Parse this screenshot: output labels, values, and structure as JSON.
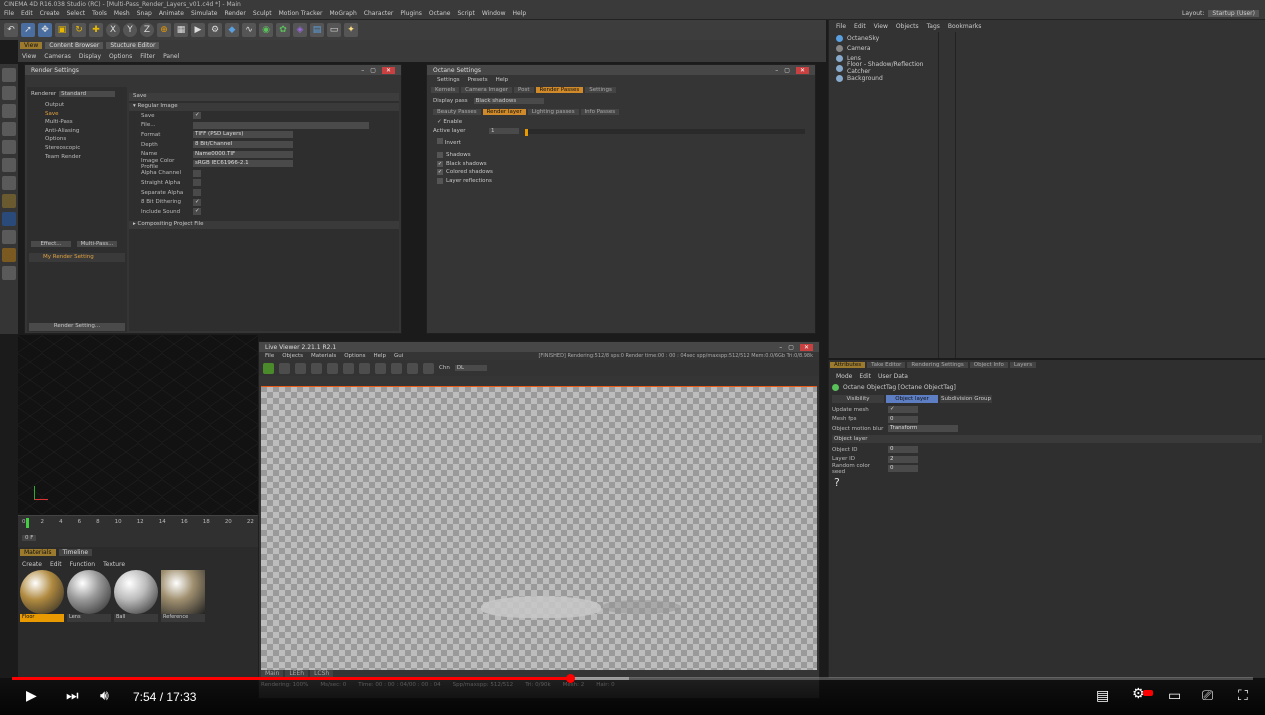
{
  "app": {
    "title": "CINEMA 4D R16.038 Studio (RC) - [Multi-Pass_Render_Layers_v01.c4d *] - Main",
    "menu": [
      "File",
      "Edit",
      "Create",
      "Select",
      "Tools",
      "Mesh",
      "Snap",
      "Animate",
      "Simulate",
      "Render",
      "Sculpt",
      "Motion Tracker",
      "MoGraph",
      "Character",
      "Plugins",
      "Octane",
      "Script",
      "Window",
      "Help"
    ],
    "layout_label": "Layout:",
    "layout_value": "Startup (User)"
  },
  "toolbar": {
    "icons": [
      "undo-icon",
      "select-icon",
      "move-icon",
      "scale-icon",
      "rotate-icon",
      "add-icon",
      "x-axis-icon",
      "y-axis-icon",
      "z-axis-icon",
      "coord-icon",
      "render-view-icon",
      "render-icon",
      "render-settings-icon",
      "cube-icon",
      "spline-icon",
      "nurbs-icon",
      "array-icon",
      "deformer-icon",
      "environment-icon",
      "camera-icon",
      "light-icon"
    ],
    "axis_x": "X",
    "axis_y": "Y",
    "axis_z": "Z"
  },
  "viewport": {
    "tabs": [
      "View",
      "Content Browser",
      "Stucture Editor"
    ],
    "menu": [
      "View",
      "Cameras",
      "Display",
      "Options",
      "Filter",
      "Panel"
    ]
  },
  "render_settings": {
    "title": "Render Settings",
    "renderer_label": "Renderer",
    "renderer_value": "Standard",
    "left_items": [
      "Output",
      "Save",
      "Multi-Pass",
      "Anti-Aliasing",
      "Options",
      "Stereoscopic",
      "Team Render"
    ],
    "effect_btn": "Effect...",
    "multipass_btn": "Multi-Pass...",
    "my_render_setting": "My Render Setting",
    "render_setting_btn": "Render Setting...",
    "section_header": "Save",
    "group_regular": "Regular Image",
    "rows": [
      {
        "label": "Save",
        "value": "✓"
      },
      {
        "label": "File...",
        "value": ""
      },
      {
        "label": "Format",
        "value": "TIFF (PSD Layers)"
      },
      {
        "label": "Depth",
        "value": "8 Bit/Channel"
      },
      {
        "label": "Name",
        "value": "Name0000.TIF"
      },
      {
        "label": "Image Color Profile",
        "value": "sRGB IEC61966-2.1"
      },
      {
        "label": "Alpha Channel",
        "value": ""
      },
      {
        "label": "Straight Alpha",
        "value": ""
      },
      {
        "label": "Separate Alpha",
        "value": ""
      },
      {
        "label": "8 Bit Dithering",
        "value": "✓"
      },
      {
        "label": "Include Sound",
        "value": "✓"
      }
    ],
    "options_btn": "Options...",
    "compositing": "Compositing Project File"
  },
  "octane_settings": {
    "title": "Octane Settings",
    "menu": [
      "Settings",
      "Presets",
      "Help"
    ],
    "tabs": [
      "Kernels",
      "Camera Imager",
      "Post",
      "Render Passes",
      "Settings"
    ],
    "display_pass_label": "Display pass",
    "display_pass_value": "Black shadows",
    "subtabs": [
      "Beauty Passes",
      "Render layer",
      "Lighting passes",
      "Info Passes"
    ],
    "enable_label": "Enable",
    "active_layer_label": "Active layer",
    "active_layer_value": "1",
    "invert_label": "Invert",
    "checks": [
      {
        "label": "Shadows",
        "checked": false
      },
      {
        "label": "Black shadows",
        "checked": true
      },
      {
        "label": "Colored shadows",
        "checked": true
      },
      {
        "label": "Layer reflections",
        "checked": false
      }
    ]
  },
  "objects": {
    "menu": [
      "File",
      "Edit",
      "View",
      "Objects",
      "Tags",
      "Bookmarks"
    ],
    "items": [
      {
        "name": "OctaneSky",
        "color": "#5aa0e0"
      },
      {
        "name": "Camera",
        "color": "#888"
      },
      {
        "name": "Lens",
        "color": "#8ac"
      },
      {
        "name": "Floor - Shadow/Reflection Catcher",
        "color": "#8ac"
      },
      {
        "name": "Background",
        "color": "#8ac"
      }
    ]
  },
  "attributes": {
    "tabs": [
      "Attributes",
      "Take Editor",
      "Rendering Settings",
      "Object Info",
      "Layers"
    ],
    "menu": [
      "Mode",
      "Edit",
      "User Data"
    ],
    "title": "Octane ObjectTag [Octane ObjectTag]",
    "subtabs": [
      "Visibility",
      "Object layer",
      "Subdivision Group"
    ],
    "rows": [
      {
        "label": "Update mesh",
        "value": "✓"
      },
      {
        "label": "Mesh fps",
        "value": "0"
      },
      {
        "label": "Object motion blur",
        "value": "Transform"
      }
    ],
    "section": "Object layer",
    "rows2": [
      {
        "label": "Object ID",
        "value": "0"
      },
      {
        "label": "Layer ID",
        "value": "2"
      },
      {
        "label": "Random color seed",
        "value": "0"
      }
    ]
  },
  "live_viewer": {
    "title": "Live Viewer 2.21.1 R2.1",
    "menu": [
      "File",
      "Objects",
      "Materials",
      "Options",
      "Help",
      "Gui"
    ],
    "status": "[FINISHED] Rendering:512/8 sps:0 Render time:00 : 00 : 04sec spp/maxspp:512/512 Mem:0.0/6Gb Tri:0/8.98k",
    "chan_label": "Chn",
    "chan_value": "DL",
    "bottom_tabs": [
      "Main",
      "LEEh",
      "LCSh"
    ],
    "footer": [
      "Rendering: 100%",
      "Ms/sec: 0",
      "Time: 00 : 00 : 04/00 : 00 : 04",
      "Spp/maxspp: 512/512",
      "Tri: 0/90k",
      "Mesh: 2",
      "Hair: 0"
    ]
  },
  "materials": {
    "tabs": [
      "Materials",
      "Timeline"
    ],
    "menu": [
      "Create",
      "Edit",
      "Function",
      "Texture"
    ],
    "items": [
      {
        "name": "Floor",
        "selected": true,
        "color": "#b08a40"
      },
      {
        "name": "Lens",
        "selected": false,
        "color": "#999"
      },
      {
        "name": "Ball",
        "selected": false,
        "color": "#bbb"
      },
      {
        "name": "Reference",
        "selected": false,
        "color": "#a09070"
      }
    ]
  },
  "timeline": {
    "ticks": [
      "0",
      "2",
      "4",
      "6",
      "8",
      "10",
      "12",
      "14",
      "16",
      "18",
      "20",
      "22"
    ],
    "frame": "0 F"
  },
  "youtube": {
    "current": "7:54",
    "separator": "/",
    "duration": "17:33",
    "progress": 0.45,
    "buffered": 0.497
  }
}
